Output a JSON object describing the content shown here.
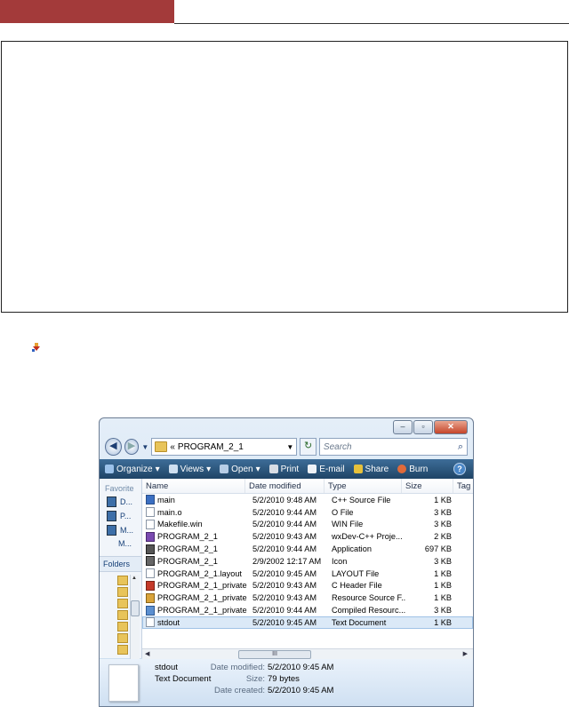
{
  "explorer": {
    "address_path": "PROGRAM_2_1",
    "search_placeholder": "Search",
    "toolbar": [
      "Organize",
      "Views",
      "Open",
      "Print",
      "E-mail",
      "Share",
      "Burn"
    ],
    "nav_pane": {
      "favorites_header": "Favorite",
      "favorites": [
        "D...",
        "P...",
        "M...",
        "M..."
      ],
      "folders_header": "Folders"
    },
    "columns": [
      "Name",
      "Date modified",
      "Type",
      "Size",
      "Tag"
    ],
    "files": [
      {
        "name": "main",
        "date": "5/2/2010 9:48 AM",
        "type": "C++ Source File",
        "size": "1 KB",
        "icon": "cpp-file-icon"
      },
      {
        "name": "main.o",
        "date": "5/2/2010 9:44 AM",
        "type": "O File",
        "size": "3 KB",
        "icon": "blank-file-icon"
      },
      {
        "name": "Makefile.win",
        "date": "5/2/2010 9:44 AM",
        "type": "WIN File",
        "size": "3 KB",
        "icon": "blank-file-icon"
      },
      {
        "name": "PROGRAM_2_1",
        "date": "5/2/2010 9:43 AM",
        "type": "wxDev-C++ Proje...",
        "size": "2 KB",
        "icon": "project-file-icon"
      },
      {
        "name": "PROGRAM_2_1",
        "date": "5/2/2010 9:44 AM",
        "type": "Application",
        "size": "697 KB",
        "icon": "application-icon"
      },
      {
        "name": "PROGRAM_2_1",
        "date": "2/9/2002 12:17 AM",
        "type": "Icon",
        "size": "3 KB",
        "icon": "icon-file-icon"
      },
      {
        "name": "PROGRAM_2_1.layout",
        "date": "5/2/2010 9:45 AM",
        "type": "LAYOUT File",
        "size": "1 KB",
        "icon": "blank-file-icon"
      },
      {
        "name": "PROGRAM_2_1_private",
        "date": "5/2/2010 9:43 AM",
        "type": "C Header File",
        "size": "1 KB",
        "icon": "header-file-icon"
      },
      {
        "name": "PROGRAM_2_1_private",
        "date": "5/2/2010 9:43 AM",
        "type": "Resource Source F...",
        "size": "1 KB",
        "icon": "resource-file-icon"
      },
      {
        "name": "PROGRAM_2_1_private",
        "date": "5/2/2010 9:44 AM",
        "type": "Compiled Resourc...",
        "size": "3 KB",
        "icon": "compiled-resource-icon"
      },
      {
        "name": "stdout",
        "date": "5/2/2010 9:45 AM",
        "type": "Text Document",
        "size": "1 KB",
        "icon": "text-file-icon",
        "selected": true
      }
    ],
    "hscroll_grip": "III",
    "details": {
      "name": "stdout",
      "type": "Text Document",
      "date_modified_label": "Date modified:",
      "date_modified": "5/2/2010 9:45 AM",
      "size_label": "Size:",
      "size": "79 bytes",
      "date_created_label": "Date created:",
      "date_created": "5/2/2010 9:45 AM"
    }
  },
  "colors": {
    "header_bar": "#a33a3a",
    "toolbar": "#2b5a84",
    "selection": "#dbe9f7"
  }
}
